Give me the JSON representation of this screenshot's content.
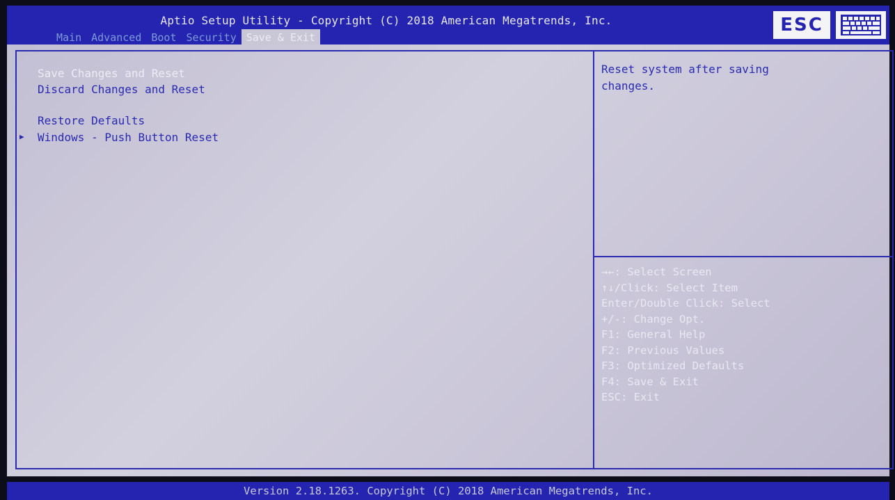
{
  "header": {
    "title": "Aptio Setup Utility - Copyright (C) 2018 American Megatrends, Inc.",
    "tabs": [
      {
        "label": "Main"
      },
      {
        "label": "Advanced"
      },
      {
        "label": "Boot"
      },
      {
        "label": "Security"
      },
      {
        "label": "Save & Exit"
      }
    ],
    "active_tab": "Save & Exit",
    "esc_label": "ESC"
  },
  "menu": {
    "items": [
      {
        "label": "Save Changes and Reset",
        "selected": true
      },
      {
        "label": "Discard Changes and Reset"
      },
      {
        "label": "Restore Defaults"
      },
      {
        "label": "Windows - Push Button Reset",
        "submenu": true
      }
    ]
  },
  "help": {
    "text": "Reset system after saving\nchanges."
  },
  "keys": [
    "→←: Select Screen",
    "↑↓/Click: Select Item",
    "Enter/Double Click: Select",
    "+/-: Change Opt.",
    "F1: General Help",
    "F2: Previous Values",
    "F3: Optimized Defaults",
    "F4: Save & Exit",
    "ESC: Exit"
  ],
  "footer": {
    "text": "Version 2.18.1263. Copyright (C) 2018 American Megatrends, Inc."
  },
  "colors": {
    "bar_blue": "#2424b0",
    "panel_lavender": "#c9c6d6",
    "text_blue": "#2a2ab0",
    "text_white": "#ececf4"
  }
}
